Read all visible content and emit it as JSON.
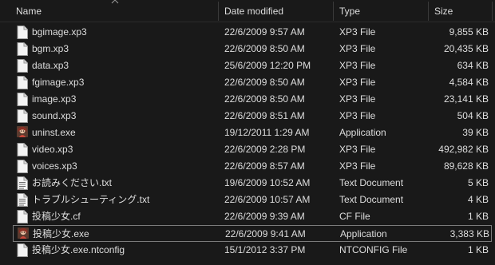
{
  "columns": {
    "name": "Name",
    "date": "Date modified",
    "type": "Type",
    "size": "Size"
  },
  "files": [
    {
      "name": "bgimage.xp3",
      "date": "22/6/2009 9:57 AM",
      "type": "XP3 File",
      "size": "9,855 KB",
      "icon": "file-icon"
    },
    {
      "name": "bgm.xp3",
      "date": "22/6/2009 8:50 AM",
      "type": "XP3 File",
      "size": "20,435 KB",
      "icon": "file-icon"
    },
    {
      "name": "data.xp3",
      "date": "25/6/2009 12:20 PM",
      "type": "XP3 File",
      "size": "634 KB",
      "icon": "file-icon"
    },
    {
      "name": "fgimage.xp3",
      "date": "22/6/2009 8:50 AM",
      "type": "XP3 File",
      "size": "4,584 KB",
      "icon": "file-icon"
    },
    {
      "name": "image.xp3",
      "date": "22/6/2009 8:50 AM",
      "type": "XP3 File",
      "size": "23,141 KB",
      "icon": "file-icon"
    },
    {
      "name": "sound.xp3",
      "date": "22/6/2009 8:51 AM",
      "type": "XP3 File",
      "size": "504 KB",
      "icon": "file-icon"
    },
    {
      "name": "uninst.exe",
      "date": "19/12/2011 1:29 AM",
      "type": "Application",
      "size": "39 KB",
      "icon": "app-icon"
    },
    {
      "name": "video.xp3",
      "date": "22/6/2009 2:28 PM",
      "type": "XP3 File",
      "size": "492,982 KB",
      "icon": "file-icon"
    },
    {
      "name": "voices.xp3",
      "date": "22/6/2009 8:57 AM",
      "type": "XP3 File",
      "size": "89,628 KB",
      "icon": "file-icon"
    },
    {
      "name": "お読みください.txt",
      "date": "19/6/2009 10:52 AM",
      "type": "Text Document",
      "size": "5 KB",
      "icon": "text-file-icon"
    },
    {
      "name": "トラブルシューティング.txt",
      "date": "22/6/2009 10:57 AM",
      "type": "Text Document",
      "size": "4 KB",
      "icon": "text-file-icon"
    },
    {
      "name": "投稿少女.cf",
      "date": "22/6/2009 9:39 AM",
      "type": "CF File",
      "size": "1 KB",
      "icon": "file-icon"
    },
    {
      "name": "投稿少女.exe",
      "date": "22/6/2009 9:41 AM",
      "type": "Application",
      "size": "3,383 KB",
      "icon": "app-icon",
      "focused": true
    },
    {
      "name": "投稿少女.exe.ntconfig",
      "date": "15/1/2012 3:37 PM",
      "type": "NTCONFIG File",
      "size": "1 KB",
      "icon": "file-icon"
    }
  ]
}
